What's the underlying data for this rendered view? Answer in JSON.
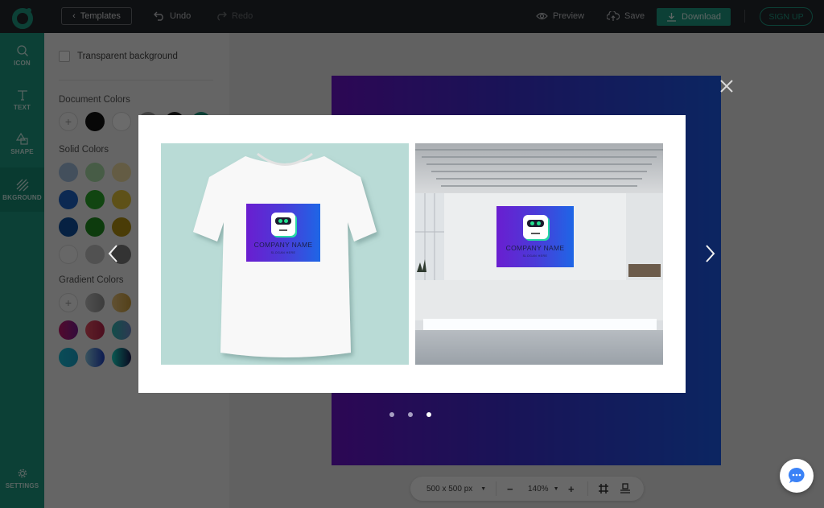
{
  "topbar": {
    "templates_label": "Templates",
    "undo_label": "Undo",
    "redo_label": "Redo",
    "preview_label": "Preview",
    "save_label": "Save",
    "download_label": "Download",
    "signup_label": "SIGN UP"
  },
  "rail": {
    "items": [
      {
        "label": "ICON",
        "icon": "search-icon"
      },
      {
        "label": "TEXT",
        "icon": "text-icon"
      },
      {
        "label": "SHAPE",
        "icon": "shape-icon"
      },
      {
        "label": "BKGROUND",
        "icon": "background-icon",
        "active": true
      },
      {
        "label": "SETTINGS",
        "icon": "gear-icon"
      }
    ]
  },
  "panel": {
    "transparent_label": "Transparent background",
    "transparent_checked": false,
    "document_colors_title": "Document Colors",
    "document_colors": [
      "#111111",
      "#ffffff",
      "#9e9e9e",
      "#222222",
      "#1e9a82"
    ],
    "solid_colors_title": "Solid Colors",
    "solid_colors": [
      "#9fbcdc",
      "#a9dba7",
      "#efdca2",
      "#1e63c4",
      "#2aa52a",
      "#e0c23a",
      "#0f4f9e",
      "#1f8d1f",
      "#b08f12",
      "#f6f6f6",
      "#c0c0c0",
      "#7a7a7a"
    ],
    "gradient_colors_title": "Gradient Colors",
    "gradient_colors": [
      [
        "#bdbdbd",
        "#8f8f8f"
      ],
      [
        "#e6c07a",
        "#c79a3a"
      ],
      [
        "#c21a6b",
        "#7a1c8f"
      ],
      [
        "#e14d5f",
        "#b5244a"
      ],
      [
        "#2fb8b0",
        "#6c86c4"
      ],
      [
        "#18b6d0",
        "#1aa0c6"
      ],
      [
        "#86c6e0",
        "#1f3fbf"
      ],
      [
        "#16d4c4",
        "#1a1a4e"
      ]
    ]
  },
  "canvas": {
    "size_label": "500 x 500 px",
    "zoom_label": "140%",
    "minus_label": "−",
    "plus_label": "+"
  },
  "modal": {
    "mockups": [
      {
        "name": "t-shirt mockup",
        "company": "COMPANY NAME",
        "slogan": "SLOGAN HERE"
      },
      {
        "name": "office wall mockup",
        "company": "COMPANY NAME",
        "slogan": "SLOGAN HERE"
      }
    ],
    "dots_count": 3,
    "active_dot": 3
  },
  "colors": {
    "accent": "#1e9a82",
    "topbar": "#23262b",
    "chat": "#3b82f6"
  }
}
